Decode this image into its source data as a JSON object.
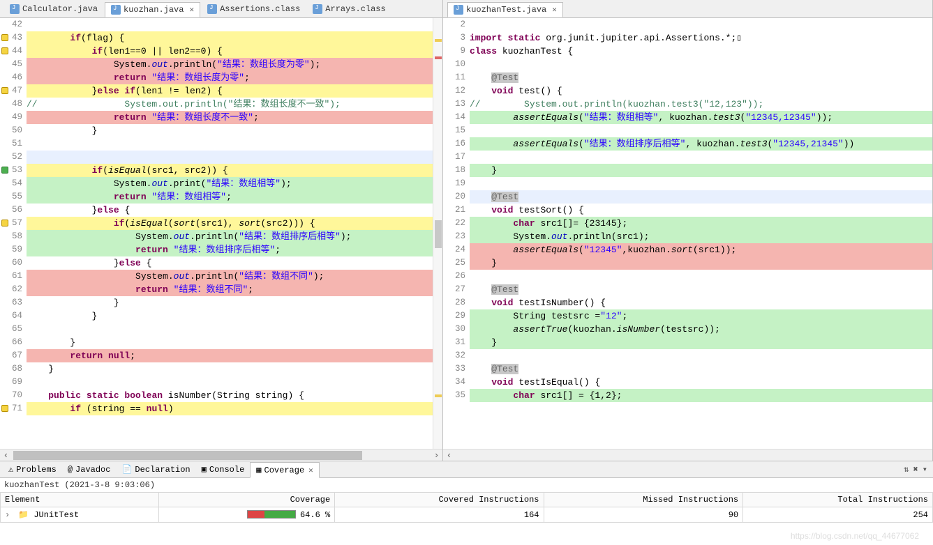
{
  "left": {
    "tabs": [
      {
        "label": "Calculator.java",
        "active": false
      },
      {
        "label": "kuozhan.java",
        "active": true
      },
      {
        "label": "Assertions.class",
        "active": false
      },
      {
        "label": "Arrays.class",
        "active": false
      }
    ],
    "lines": [
      {
        "n": 42,
        "hl": "",
        "marker": "",
        "html": ""
      },
      {
        "n": 43,
        "hl": "hl-y",
        "marker": "gm-y",
        "html": "        <span class='kw'>if</span>(flag) {"
      },
      {
        "n": 44,
        "hl": "hl-y",
        "marker": "gm-y",
        "html": "            <span class='kw'>if</span>(len1==0 || len2==0) {"
      },
      {
        "n": 45,
        "hl": "hl-r",
        "marker": "",
        "html": "                System.<span class='fld'>out</span>.println(<span class='st'>\"结果：数组长度为零\"</span>);"
      },
      {
        "n": 46,
        "hl": "hl-r",
        "marker": "",
        "html": "                <span class='kw'>return</span> <span class='st'>\"结果：数组长度为零\"</span>;"
      },
      {
        "n": 47,
        "hl": "hl-y",
        "marker": "gm-y",
        "html": "            }<span class='kw'>else if</span>(len1 != len2) {"
      },
      {
        "n": 48,
        "hl": "",
        "marker": "",
        "html": "<span class='cm'>//                System.out.println(\"结果：数组长度不一致\");</span>"
      },
      {
        "n": 49,
        "hl": "hl-r",
        "marker": "",
        "html": "                <span class='kw'>return</span> <span class='st'>\"结果：数组长度不一致\"</span>;"
      },
      {
        "n": 50,
        "hl": "",
        "marker": "",
        "html": "            }"
      },
      {
        "n": 51,
        "hl": "",
        "marker": "",
        "html": ""
      },
      {
        "n": 52,
        "hl": "hl-cur",
        "marker": "",
        "html": ""
      },
      {
        "n": 53,
        "hl": "hl-y",
        "marker": "gm-g",
        "html": "            <span class='kw'>if</span>(<span class='mi'>isEqual</span>(src1, src2)) {"
      },
      {
        "n": 54,
        "hl": "hl-g",
        "marker": "",
        "html": "                System.<span class='fld'>out</span>.print(<span class='st'>\"结果：数组相等\"</span>);"
      },
      {
        "n": 55,
        "hl": "hl-g",
        "marker": "",
        "html": "                <span class='kw'>return</span> <span class='st'>\"结果：数组相等\"</span>;"
      },
      {
        "n": 56,
        "hl": "",
        "marker": "",
        "html": "            }<span class='kw'>else</span> {"
      },
      {
        "n": 57,
        "hl": "hl-y",
        "marker": "gm-y",
        "html": "                <span class='kw'>if</span>(<span class='mi'>isEqual</span>(<span class='mi'>sort</span>(src1), <span class='mi'>sort</span>(src2))) {"
      },
      {
        "n": 58,
        "hl": "hl-g",
        "marker": "",
        "html": "                    System.<span class='fld'>out</span>.println(<span class='st'>\"结果：数组排序后相等\"</span>);"
      },
      {
        "n": 59,
        "hl": "hl-g",
        "marker": "",
        "html": "                    <span class='kw'>return</span> <span class='st'>\"结果：数组排序后相等\"</span>;"
      },
      {
        "n": 60,
        "hl": "",
        "marker": "",
        "html": "                }<span class='kw'>else</span> {"
      },
      {
        "n": 61,
        "hl": "hl-r",
        "marker": "",
        "html": "                    System.<span class='fld'>out</span>.println(<span class='st'>\"结果：数组不同\"</span>);"
      },
      {
        "n": 62,
        "hl": "hl-r",
        "marker": "",
        "html": "                    <span class='kw'>return</span> <span class='st'>\"结果：数组不同\"</span>;"
      },
      {
        "n": 63,
        "hl": "",
        "marker": "",
        "html": "                }"
      },
      {
        "n": 64,
        "hl": "",
        "marker": "",
        "html": "            }"
      },
      {
        "n": 65,
        "hl": "",
        "marker": "",
        "html": ""
      },
      {
        "n": 66,
        "hl": "",
        "marker": "",
        "html": "        }"
      },
      {
        "n": 67,
        "hl": "hl-r",
        "marker": "",
        "html": "        <span class='kw'>return null</span>;"
      },
      {
        "n": 68,
        "hl": "",
        "marker": "",
        "html": "    }"
      },
      {
        "n": 69,
        "hl": "",
        "marker": "",
        "html": ""
      },
      {
        "n": 70,
        "hl": "",
        "marker": "",
        "html": "    <span class='kw'>public static boolean</span> isNumber(String string) {"
      },
      {
        "n": 71,
        "hl": "hl-y",
        "marker": "gm-y",
        "html": "        <span class='kw'>if</span> (string == <span class='kw'>null</span>)"
      }
    ]
  },
  "right": {
    "tabs": [
      {
        "label": "kuozhanTest.java",
        "active": true
      }
    ],
    "lines": [
      {
        "n": 2,
        "hl": "",
        "marker": "",
        "html": ""
      },
      {
        "n": 3,
        "hl": "",
        "marker": "fold",
        "html": "<span class='kw'>import static</span> org.junit.jupiter.api.Assertions.*;&#x25AF;"
      },
      {
        "n": 9,
        "hl": "",
        "marker": "",
        "html": "<span class='kw'>class</span> kuozhanTest {"
      },
      {
        "n": 10,
        "hl": "",
        "marker": "",
        "html": ""
      },
      {
        "n": 11,
        "hl": "",
        "marker": "fold",
        "html": "    <span class='an'>@Test</span>"
      },
      {
        "n": 12,
        "hl": "",
        "marker": "",
        "html": "    <span class='kw'>void</span> test() {"
      },
      {
        "n": 13,
        "hl": "",
        "marker": "",
        "html": "<span class='cm'>//        System.out.println(kuozhan.test3(\"12,123\"));</span>"
      },
      {
        "n": 14,
        "hl": "hl-g",
        "marker": "",
        "html": "        <span class='mi'>assertEquals</span>(<span class='st'>\"结果：数组相等\"</span>, kuozhan.<span class='mi'>test3</span>(<span class='st'>\"12345,12345\"</span>));"
      },
      {
        "n": 15,
        "hl": "",
        "marker": "",
        "html": ""
      },
      {
        "n": 16,
        "hl": "hl-g",
        "marker": "",
        "html": "        <span class='mi'>assertEquals</span>(<span class='st'>\"结果：数组排序后相等\"</span>, kuozhan.<span class='mi'>test3</span>(<span class='st'>\"12345,21345\"</span>))"
      },
      {
        "n": 17,
        "hl": "",
        "marker": "",
        "html": ""
      },
      {
        "n": 18,
        "hl": "hl-g",
        "marker": "",
        "html": "    }"
      },
      {
        "n": 19,
        "hl": "",
        "marker": "",
        "html": ""
      },
      {
        "n": 20,
        "hl": "hl-cur",
        "marker": "fold",
        "html": "    <span class='an'>@Test</span>"
      },
      {
        "n": 21,
        "hl": "",
        "marker": "",
        "html": "    <span class='kw'>void</span> testSort() {"
      },
      {
        "n": 22,
        "hl": "hl-g",
        "marker": "",
        "html": "        <span class='kw'>char</span> src1[]= {23145};"
      },
      {
        "n": 23,
        "hl": "hl-g",
        "marker": "",
        "html": "        System.<span class='fld'>out</span>.println(src1);"
      },
      {
        "n": 24,
        "hl": "hl-r",
        "marker": "",
        "html": "        <span class='mi'>assertEquals</span>(<span class='st'>\"12345\"</span>,kuozhan.<span class='mi'>sort</span>(src1));"
      },
      {
        "n": 25,
        "hl": "hl-r",
        "marker": "",
        "html": "    }"
      },
      {
        "n": 26,
        "hl": "",
        "marker": "",
        "html": ""
      },
      {
        "n": 27,
        "hl": "",
        "marker": "fold",
        "html": "    <span class='an'>@Test</span>"
      },
      {
        "n": 28,
        "hl": "",
        "marker": "",
        "html": "    <span class='kw'>void</span> testIsNumber() {"
      },
      {
        "n": 29,
        "hl": "hl-g",
        "marker": "",
        "html": "        String testsrc =<span class='st'>\"12\"</span>;"
      },
      {
        "n": 30,
        "hl": "hl-g",
        "marker": "",
        "html": "        <span class='mi'>assertTrue</span>(kuozhan.<span class='mi'>isNumber</span>(testsrc));"
      },
      {
        "n": 31,
        "hl": "hl-g",
        "marker": "",
        "html": "    }"
      },
      {
        "n": 32,
        "hl": "",
        "marker": "",
        "html": ""
      },
      {
        "n": 33,
        "hl": "",
        "marker": "fold",
        "html": "    <span class='an'>@Test</span>"
      },
      {
        "n": 34,
        "hl": "",
        "marker": "",
        "html": "    <span class='kw'>void</span> testIsEqual() {"
      },
      {
        "n": 35,
        "hl": "hl-g",
        "marker": "",
        "html": "        <span class='kw'>char</span> src1[] = {1,2};"
      }
    ]
  },
  "bottom": {
    "tabs": [
      {
        "label": "Problems",
        "icon": "⚠"
      },
      {
        "label": "Javadoc",
        "icon": "@"
      },
      {
        "label": "Declaration",
        "icon": "📄"
      },
      {
        "label": "Console",
        "icon": "▣"
      },
      {
        "label": "Coverage",
        "icon": "▦",
        "active": true
      }
    ],
    "caption": "kuozhanTest (2021-3-8 9:03:06)",
    "headers": [
      "Element",
      "Coverage",
      "Covered Instructions",
      "Missed Instructions",
      "Total Instructions"
    ],
    "row": {
      "element": "JUnitTest",
      "coverage": "64.6 %",
      "covered": "164",
      "missed": "90",
      "total": "254"
    }
  },
  "watermark": "https://blog.csdn.net/qq_44677062"
}
